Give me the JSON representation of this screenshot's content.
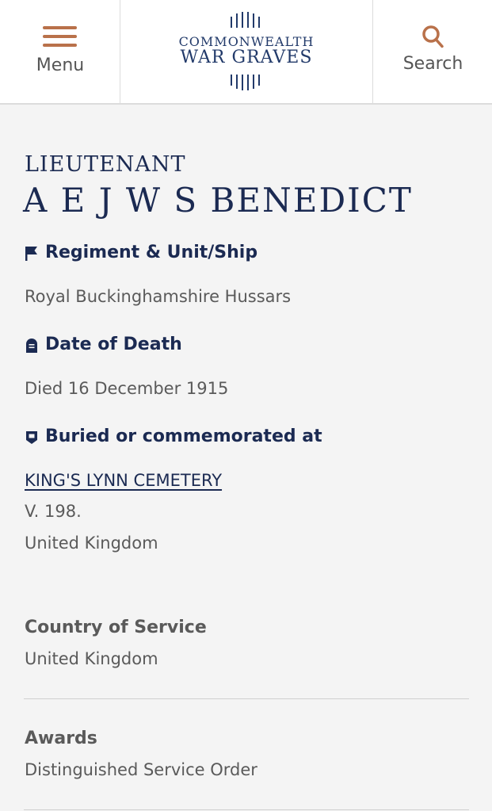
{
  "header": {
    "menu_label": "Menu",
    "logo_line1": "COMMONWEALTH",
    "logo_line2": "WAR GRAVES",
    "search_label": "Search"
  },
  "person": {
    "rank": "LIEUTENANT",
    "name": "A E J W S BENEDICT"
  },
  "sections": {
    "regiment": {
      "title": "Regiment & Unit/Ship",
      "value": "Royal Buckinghamshire Hussars"
    },
    "date_of_death": {
      "title": "Date of Death",
      "value": "Died 16 December 1915"
    },
    "buried": {
      "title": "Buried or commemorated at",
      "cemetery": "KING'S LYNN CEMETERY",
      "grave_ref": "V. 198.",
      "country": "United Kingdom"
    }
  },
  "details": {
    "country_of_service_label": "Country of Service",
    "country_of_service_value": "United Kingdom",
    "awards_label": "Awards",
    "awards_value": "Distinguished Service Order"
  },
  "colors": {
    "accent": "#b9714a",
    "navy": "#1b2a52",
    "text": "#5a5a5a",
    "background": "#f4f4f4"
  },
  "icons": {
    "menu": "hamburger-icon",
    "search": "search-icon",
    "regiment": "flag-icon",
    "date_of_death": "headstone-icon",
    "buried": "location-icon"
  }
}
